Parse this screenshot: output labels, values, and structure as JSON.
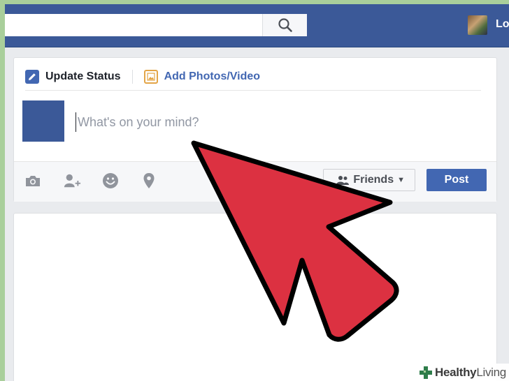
{
  "colors": {
    "facebook_blue": "#3b5998",
    "button_blue": "#4267b2",
    "arrow_red": "#dc3141",
    "frame_green": "#a9cf9b"
  },
  "header": {
    "search": {
      "value": "",
      "placeholder": "",
      "icon": "search-icon"
    },
    "user": {
      "name_partial": "Lo",
      "avatar_icon": "profile-photo"
    }
  },
  "composer": {
    "tabs": [
      {
        "label": "Update Status",
        "icon": "pencil-icon",
        "active": true
      },
      {
        "label": "Add Photos/Video",
        "icon": "photo-icon",
        "active": false
      }
    ],
    "status": {
      "value": "",
      "placeholder": "What's on your mind?"
    },
    "footer": {
      "actions": [
        {
          "icon": "camera-icon"
        },
        {
          "icon": "tag-friend-icon"
        },
        {
          "icon": "feeling-icon"
        },
        {
          "icon": "location-pin-icon"
        }
      ],
      "privacy": {
        "label": "Friends",
        "icon": "people-icon",
        "caret": "▼"
      },
      "post_label": "Post"
    }
  },
  "overlay": {
    "icon": "red-pointer-arrow-icon"
  },
  "watermark": {
    "brand": "Healthy",
    "suffix": "Living",
    "icon": "plus-cross-icon"
  }
}
